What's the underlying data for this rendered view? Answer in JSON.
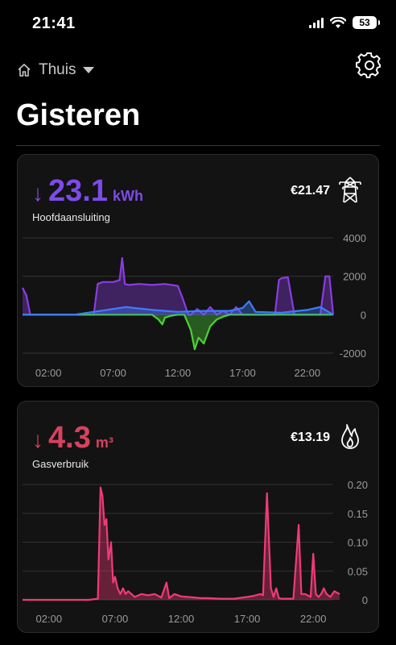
{
  "status": {
    "time": "21:41",
    "battery": "53"
  },
  "header": {
    "location": "Thuis"
  },
  "page_title": "Gisteren",
  "electricity": {
    "arrow": "↓",
    "value": "23.1",
    "unit": "kWh",
    "label": "Hoofdaansluiting",
    "price": "€21.47",
    "icon": "power-pylon-icon",
    "colors": {
      "accent": "#7d4bea",
      "purple": "#8a3de0",
      "green": "#4cd137",
      "blue": "#3f7bff"
    }
  },
  "gas": {
    "arrow": "↓",
    "value": "4.3",
    "unit": "m³",
    "label": "Gasverbruik",
    "price": "€13.19",
    "icon": "flame-icon",
    "colors": {
      "accent": "#d6425f",
      "line": "#f03a7a"
    }
  },
  "chart_data": [
    {
      "type": "area",
      "ylim": [
        -2000,
        4000
      ],
      "y_ticks": [
        "4000",
        "2000",
        "0",
        "-2000"
      ],
      "x_ticks": [
        "02:00",
        "07:00",
        "12:00",
        "17:00",
        "22:00"
      ],
      "grid": true,
      "series": [
        {
          "color": "#8a3de0",
          "x": [
            0,
            0.3,
            0.6,
            1,
            2,
            3,
            4,
            5,
            5.5,
            5.8,
            6.2,
            7,
            7.5,
            7.7,
            7.9,
            8.2,
            9,
            10,
            11,
            12,
            12.4,
            12.8,
            13,
            13.5,
            14,
            14.5,
            15,
            15.5,
            16,
            16.5,
            17,
            18,
            19,
            19.5,
            19.8,
            20,
            20.5,
            21,
            21.4,
            22,
            22.5,
            23,
            23.4,
            23.7,
            24
          ],
          "y": [
            1400,
            1000,
            0,
            0,
            0,
            0,
            0,
            0,
            0,
            1600,
            1700,
            1700,
            1800,
            2950,
            1600,
            1550,
            1600,
            1550,
            1600,
            1500,
            800,
            0,
            0,
            300,
            0,
            400,
            0,
            200,
            0,
            400,
            0,
            0,
            0,
            0,
            1800,
            1900,
            1950,
            0,
            0,
            0,
            0,
            0,
            2000,
            2000,
            0
          ]
        },
        {
          "color": "#4cd137",
          "x": [
            0,
            10,
            10.5,
            10.8,
            11,
            11.5,
            12,
            12.5,
            13,
            13.3,
            13.6,
            14,
            14.5,
            15,
            15.5,
            16,
            17,
            24
          ],
          "y": [
            0,
            0,
            -250,
            -500,
            -150,
            -50,
            0,
            0,
            -800,
            -1800,
            -1200,
            -1500,
            -600,
            -250,
            -100,
            0,
            0,
            0
          ]
        },
        {
          "color": "#3f7bff",
          "x": [
            0,
            2,
            4,
            6,
            8,
            10,
            12,
            14,
            16,
            17,
            17.5,
            18,
            20,
            22,
            23,
            24
          ],
          "y": [
            0,
            0,
            0,
            200,
            400,
            250,
            150,
            200,
            200,
            350,
            700,
            150,
            100,
            250,
            400,
            0
          ]
        }
      ]
    },
    {
      "type": "area",
      "ylim": [
        0,
        0.2
      ],
      "y_ticks": [
        "0.20",
        "0.15",
        "0.10",
        "0.05",
        "0"
      ],
      "x_ticks": [
        "02:00",
        "07:00",
        "12:00",
        "17:00",
        "22:00"
      ],
      "grid": true,
      "series": [
        {
          "color": "#f03a7a",
          "x": [
            0,
            1,
            2,
            3,
            4,
            5,
            5.7,
            5.9,
            6.05,
            6.2,
            6.35,
            6.5,
            6.7,
            6.85,
            7,
            7.2,
            7.4,
            7.6,
            7.8,
            8,
            8.5,
            9,
            9.5,
            10,
            10.5,
            10.9,
            11.1,
            11.5,
            12,
            12.5,
            13,
            13.5,
            14,
            15,
            16,
            17,
            17.5,
            18,
            18.2,
            18.5,
            18.8,
            19,
            19.2,
            19.4,
            19.6,
            20,
            20.5,
            20.9,
            21.1,
            21.4,
            21.8,
            22,
            22.2,
            22.4,
            22.6,
            22.8,
            23,
            23.3,
            23.6,
            24
          ],
          "y": [
            0,
            0,
            0,
            0,
            0,
            0,
            0.002,
            0.195,
            0.18,
            0.13,
            0.14,
            0.07,
            0.1,
            0.03,
            0.04,
            0.02,
            0.01,
            0.02,
            0.01,
            0.015,
            0.005,
            0.01,
            0.008,
            0.01,
            0.004,
            0.03,
            0.003,
            0.01,
            0.006,
            0.005,
            0.004,
            0.003,
            0.003,
            0.002,
            0.002,
            0.005,
            0.007,
            0.01,
            0.008,
            0.185,
            0.02,
            0.005,
            0.02,
            0.003,
            0.002,
            0.002,
            0.002,
            0.13,
            0.01,
            0.01,
            0.005,
            0.08,
            0.01,
            0.005,
            0.01,
            0.02,
            0.01,
            0.005,
            0.015,
            0.01
          ]
        }
      ]
    }
  ]
}
